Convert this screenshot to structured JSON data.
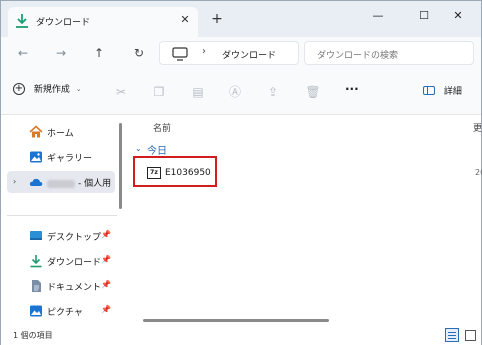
{
  "tab": {
    "title": "ダウンロード",
    "close": "✕",
    "new_tab": "+"
  },
  "window_controls": {
    "minimize": "—",
    "maximize": "☐",
    "close": "✕"
  },
  "navigation": {
    "back": "←",
    "forward": "→",
    "up": "↑",
    "refresh": "↻"
  },
  "address": {
    "chevron": "›",
    "location": "ダウンロード"
  },
  "search": {
    "placeholder": "ダウンロードの検索"
  },
  "toolbar": {
    "new_label": "新規作成",
    "new_caret": "⌄",
    "more": "···",
    "details_label": "詳細"
  },
  "sidebar": {
    "items": [
      {
        "label": "ホーム",
        "icon": "home-icon"
      },
      {
        "label": "ギャラリー",
        "icon": "gallery-icon"
      },
      {
        "label": "- 個人用",
        "icon": "onedrive-icon",
        "expand": "›"
      },
      {
        "label": "デスクトップ",
        "icon": "desktop-icon",
        "pin": "📌"
      },
      {
        "label": "ダウンロード",
        "icon": "download-icon",
        "pin": "📌"
      },
      {
        "label": "ドキュメント",
        "icon": "documents-icon",
        "pin": "📌"
      },
      {
        "label": "ピクチャ",
        "icon": "pictures-icon",
        "pin": "📌"
      }
    ]
  },
  "list": {
    "column_name": "名前",
    "column_date_partial": "更",
    "group_chevron": "⌄",
    "group_label": "今日",
    "files": [
      {
        "name": "E1036950",
        "icon_text": "7z",
        "date_partial": "20"
      }
    ]
  },
  "status": {
    "item_count": "1 個の項目"
  },
  "colors": {
    "accent": "#2a6db5",
    "highlight_box": "#d21d1d",
    "download_green": "#1f9e6e",
    "onedrive_blue": "#1b74d1"
  }
}
